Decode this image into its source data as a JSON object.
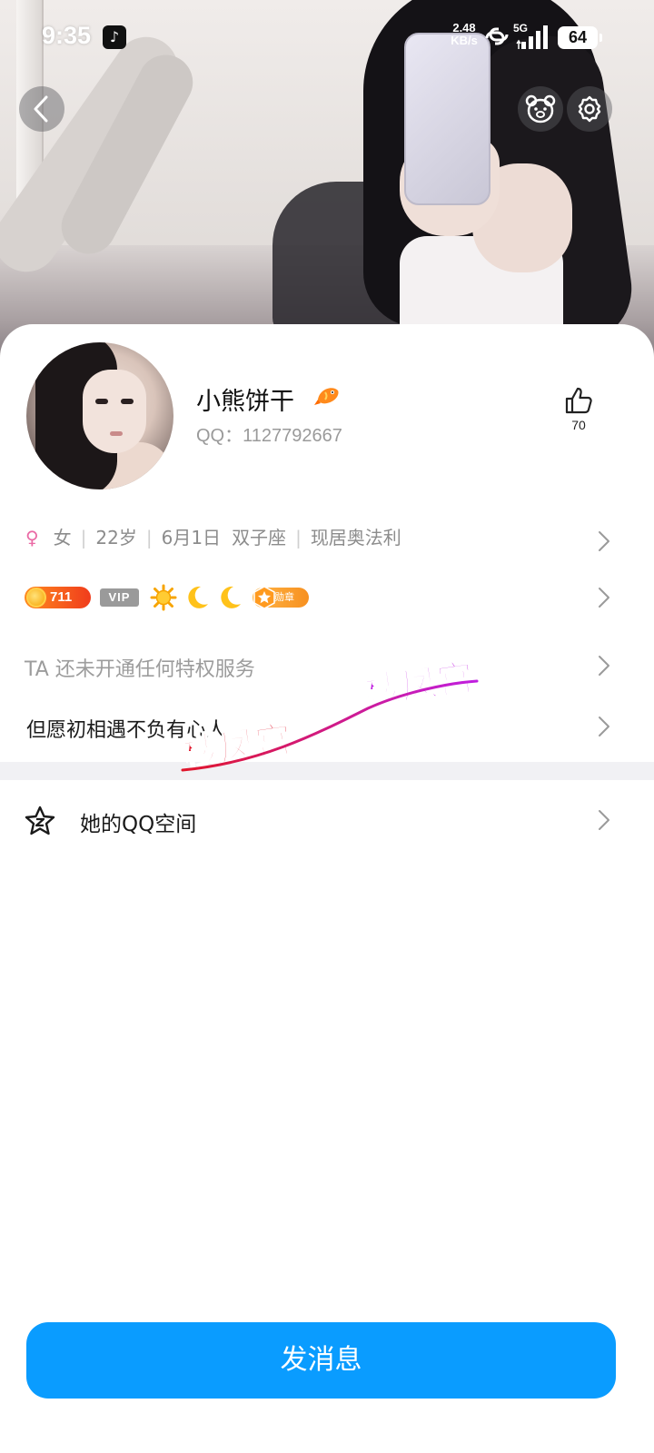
{
  "status_bar": {
    "time": "9:35",
    "net_speed_value": "2.48",
    "net_speed_unit": "KB/s",
    "network_type": "5G",
    "battery": "64",
    "app_icon": "tiktok-icon"
  },
  "header": {
    "back_icon": "chevron-left-icon",
    "pet_icon": "bear-face-icon",
    "settings_icon": "gear-icon"
  },
  "profile": {
    "nickname": "小熊饼干",
    "nickname_badge_icon": "koi-fish-icon",
    "qq_number": "QQ：1127792667",
    "likes": "70",
    "like_icon": "thumbs-up-icon"
  },
  "info": {
    "gender_symbol": "♀",
    "gender": "女",
    "age": "22岁",
    "birthday": "6月1日",
    "zodiac": "双子座",
    "location": "现居奥法利"
  },
  "badges": {
    "level": "711",
    "vip": "VIP",
    "medal": "勋章",
    "level_icons": [
      "sun-icon",
      "moon-icon",
      "moon-icon"
    ]
  },
  "privilege_text": "TA 还未开通任何特权服务",
  "signature": "但愿初相遇不负有心人",
  "qzone": {
    "label": "她的QQ空间",
    "icon": "star-icon"
  },
  "watermark": {
    "text_1": "楼凤宫",
    "text_2": "楼凤宫"
  },
  "send_button": "发消息",
  "colors": {
    "primary": "#0a9cff",
    "female": "#ea6aa5",
    "level_badge": "#f03c1c",
    "watermark_red": "#e0162b",
    "watermark_purple": "#c01ee0"
  }
}
